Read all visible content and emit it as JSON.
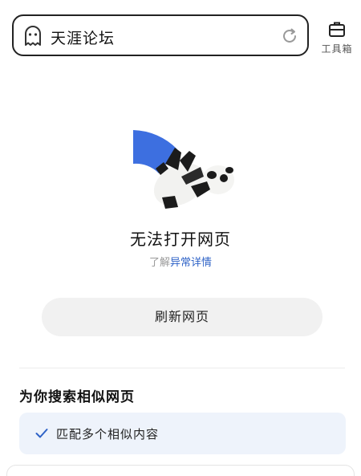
{
  "search": {
    "value": "天涯论坛",
    "ghost_icon": "ghost-icon",
    "refresh_icon": "refresh-icon"
  },
  "toolbox": {
    "icon": "toolbox-icon",
    "label": "工具箱"
  },
  "error": {
    "title": "无法打开网页",
    "details_prefix": "了解",
    "details_link": "异常详情"
  },
  "actions": {
    "refresh_label": "刷新网页"
  },
  "suggestions": {
    "section_title": "为你搜索相似网页",
    "items": [
      {
        "icon": "check-icon",
        "label": "匹配多个相似内容"
      }
    ]
  },
  "colors": {
    "accent": "#2f63c7",
    "illustration_blue": "#3d6fe0",
    "button_bg": "#f1f1f1",
    "card_bg": "#eef3fb"
  }
}
